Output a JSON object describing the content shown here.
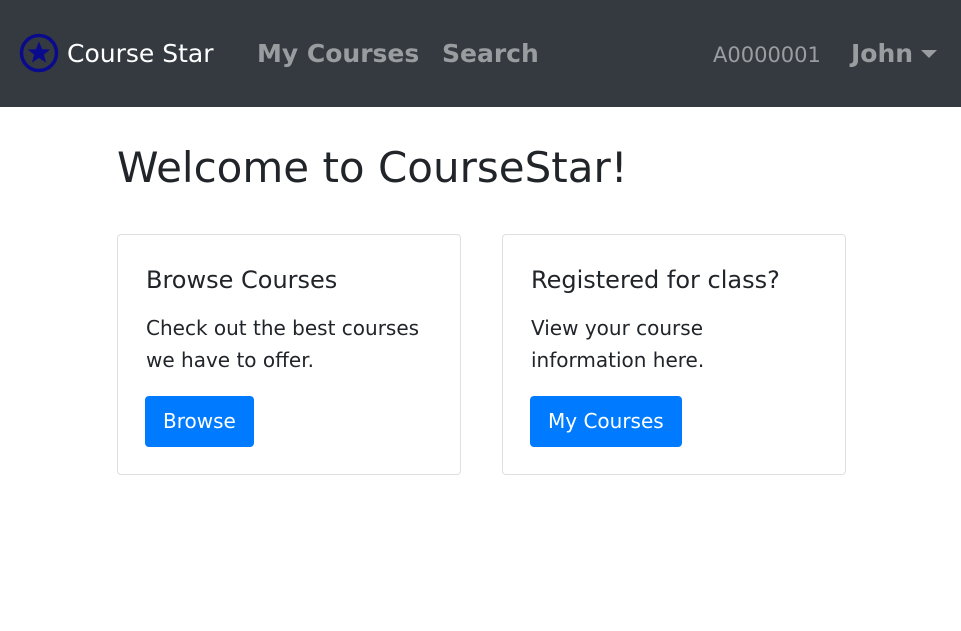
{
  "navbar": {
    "brand": {
      "icon": "star-circle-icon",
      "label": "Course Star",
      "icon_color": "#0a0a8c"
    },
    "links": [
      {
        "label": "My Courses"
      },
      {
        "label": "Search"
      }
    ],
    "user_id": "A0000001",
    "user_name": "John",
    "user_menu_icon": "caret-down-icon",
    "background": "#343a40"
  },
  "main": {
    "title": "Welcome to CourseStar!",
    "cards": [
      {
        "title": "Browse Courses",
        "text": "Check out the best courses we have to offer.",
        "button_label": "Browse"
      },
      {
        "title": "Registered for class?",
        "text": "View your course information here.",
        "button_label": "My Courses"
      }
    ]
  },
  "colors": {
    "primary_button": "#007bff",
    "card_border": "#dfdfdf"
  }
}
